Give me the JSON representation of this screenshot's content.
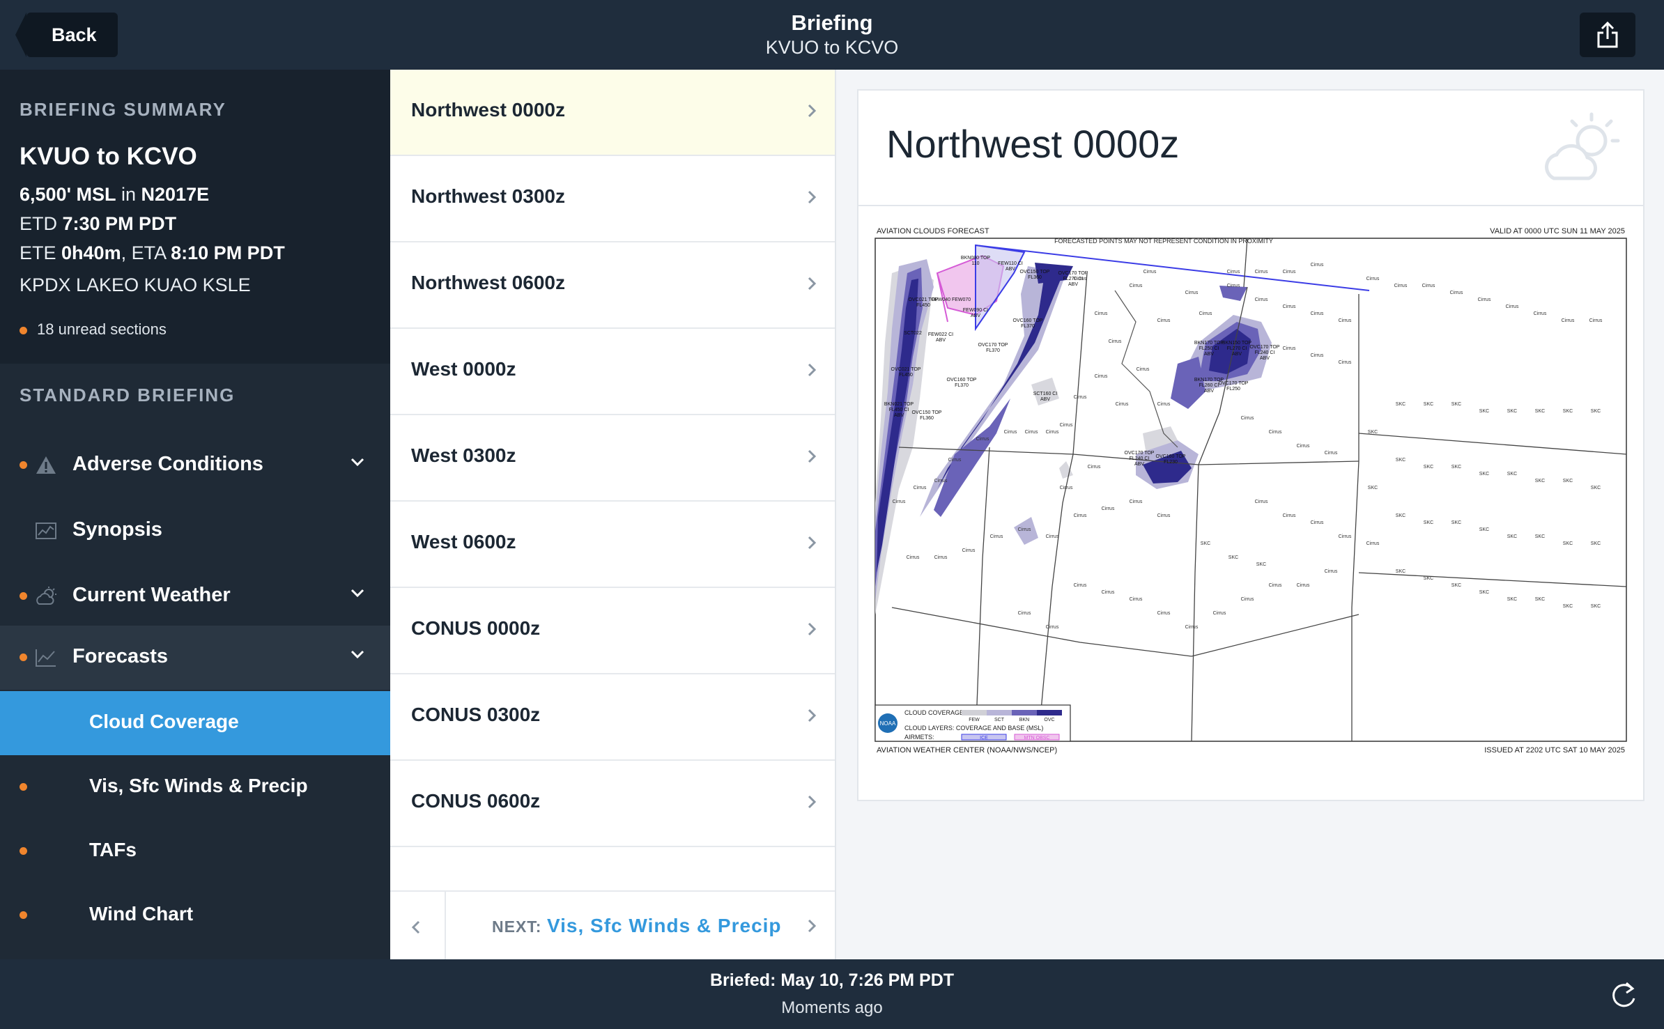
{
  "header": {
    "back_label": "Back",
    "title": "Briefing",
    "subtitle": "KVUO to KCVO",
    "share_icon": "share-icon"
  },
  "summary": {
    "section_title": "BRIEFING SUMMARY",
    "route": "KVUO to KCVO",
    "altitude": "6,500' MSL",
    "altitude_sep": "in",
    "aircraft": "N2017E",
    "etd_label": "ETD",
    "etd": "7:30 PM PDT",
    "ete_label": "ETE",
    "ete": "0h40m",
    "eta_label": ", ETA",
    "eta": "8:10 PM PDT",
    "waypoints": "KPDX LAKEO KUAO KSLE",
    "unread": "18 unread sections"
  },
  "standard": {
    "section_title": "STANDARD BRIEFING",
    "items": [
      {
        "label": "Adverse Conditions",
        "icon": "warning-icon",
        "unread": true,
        "expandable": true
      },
      {
        "label": "Synopsis",
        "icon": "chart-icon",
        "unread": false,
        "expandable": false
      },
      {
        "label": "Current Weather",
        "icon": "partly-cloudy-icon",
        "unread": true,
        "expandable": true
      },
      {
        "label": "Forecasts",
        "icon": "line-chart-icon",
        "unread": true,
        "expandable": true
      }
    ],
    "subitems": [
      {
        "label": "Cloud Coverage",
        "active": true
      },
      {
        "label": "Vis, Sfc Winds & Precip",
        "unread": true
      },
      {
        "label": "TAFs",
        "unread": true
      },
      {
        "label": "Wind Chart",
        "unread": true
      }
    ]
  },
  "list": {
    "items": [
      "Northwest 0000z",
      "Northwest 0300z",
      "Northwest 0600z",
      "West 0000z",
      "West 0300z",
      "West 0600z",
      "CONUS 0000z",
      "CONUS 0300z",
      "CONUS 0600z"
    ],
    "selected_index": 0,
    "next_prefix": "NEXT:",
    "next_label": "Vis, Sfc Winds & Precip"
  },
  "detail": {
    "title": "Northwest 0000z",
    "icon": "partly-cloudy-icon",
    "map": {
      "top_left": "AVIATION CLOUDS FORECAST",
      "top_right": "VALID AT 0000 UTC SUN 11 MAY 2025",
      "notice": "FORECASTED POINTS MAY NOT REPRESENT CONDITION IN PROXIMITY",
      "bottom_left": "AVIATION WEATHER CENTER (NOAA/NWS/NCEP)",
      "bottom_right": "ISSUED AT 2202 UTC SAT 10 MAY 2025",
      "legend": {
        "coverage_label": "CLOUD COVERAGE",
        "coverage_levels": [
          "FEW",
          "SCT",
          "BKN",
          "OVC"
        ],
        "layers_label": "CLOUD LAYERS: COVERAGE AND BASE (MSL)",
        "airmets_label": "AIRMETS:",
        "ice_label": "ICE",
        "mtn_label": "MTN OBSC",
        "logo_text": "NOAA"
      },
      "labels": [
        "BKN080 TOP 110",
        "FEW110 CI ABV",
        "OVC150 TOP FL360",
        "OVC170 TOP FL270 CI ABV",
        "OVC021 TOP FL450",
        "FEW040 FEW070",
        "FEW090 CI ABV",
        "OVC160 TOP FL370",
        "SCT022",
        "FEW022 CI ABV",
        "OVC170 TOP FL370",
        "OVC021 TOP FL450",
        "OVC160 TOP FL370",
        "SCT160 CI ABV",
        "BKN021 TOP FL450 CI ABV",
        "OVC150 TOP FL360",
        "BKN170 TOP FL250 CI ABV",
        "BKN150 TOP FL270 CI ABV",
        "OVC170 TOP FL240 CI ABV",
        "BKN170 TOP FL260 CI ABV",
        "OVC170 TOP FL250",
        "OVC170 TOP FL240 CI ABV",
        "OVC160 TOP FL230",
        "Cirrus",
        "SKC"
      ]
    }
  },
  "footer": {
    "briefed": "Briefed: May 10, 7:26 PM PDT",
    "relative": "Moments ago",
    "refresh_icon": "refresh-icon"
  },
  "colors": {
    "header_bg": "#1f2d3d",
    "sidebar_bg": "#1f2a36",
    "active": "#3499dd",
    "unread_dot": "#f0852d",
    "selected_row": "#fdfde9",
    "ovc": "#2e2a8c",
    "bkn": "#6a63b8",
    "sct": "#b8b5d8",
    "few": "#d0d0d6"
  }
}
